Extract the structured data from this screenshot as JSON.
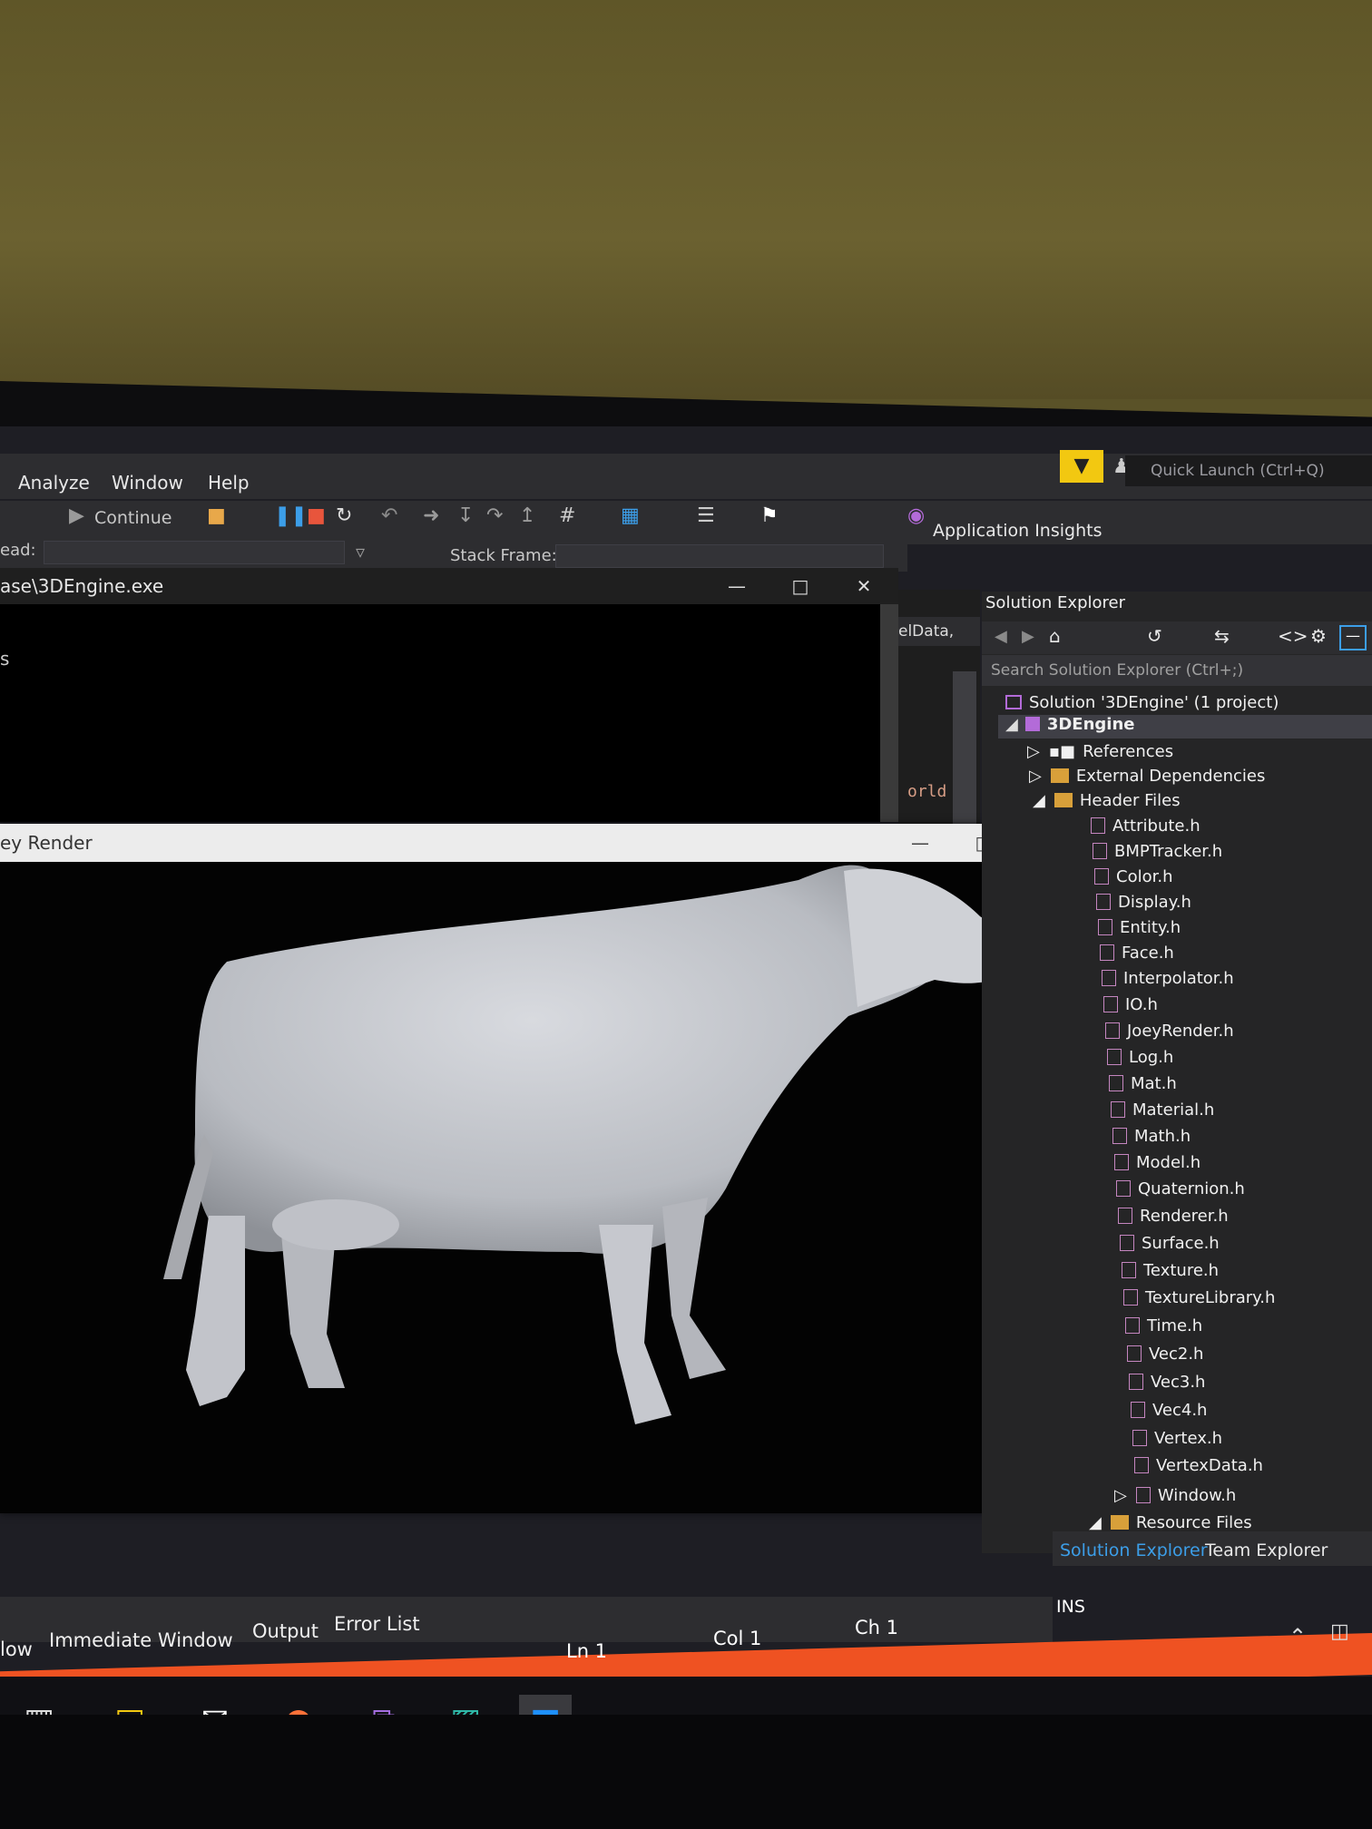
{
  "menu": {
    "items": [
      "Analyze",
      "Window",
      "Help"
    ],
    "quick_launch": "Quick Launch (Ctrl+Q)"
  },
  "toolbar": {
    "continue_label": "Continue",
    "application_insights": "Application Insights",
    "thread_label": "ead:",
    "stack_frame_label": "Stack Frame:"
  },
  "console": {
    "title": "ase\\3DEngine.exe",
    "text": "s"
  },
  "editor": {
    "tab_label": "elData,",
    "code_fragment": "orld"
  },
  "render_window": {
    "title": "ey Render"
  },
  "solution_explorer": {
    "title": "Solution Explorer",
    "search_placeholder": "Search Solution Explorer (Ctrl+;)",
    "solution": "Solution '3DEngine' (1 project)",
    "project": "3DEngine",
    "references": "References",
    "external_dependencies": "External Dependencies",
    "header_files": "Header Files",
    "files": [
      "Attribute.h",
      "BMPTracker.h",
      "Color.h",
      "Display.h",
      "Entity.h",
      "Face.h",
      "Interpolator.h",
      "IO.h",
      "JoeyRender.h",
      "Log.h",
      "Mat.h",
      "Material.h",
      "Math.h",
      "Model.h",
      "Quaternion.h",
      "Renderer.h",
      "Surface.h",
      "Texture.h",
      "TextureLibrary.h",
      "Time.h",
      "Vec2.h",
      "Vec3.h",
      "Vec4.h",
      "Vertex.h",
      "VertexData.h",
      "Window.h"
    ],
    "resource_files": "Resource Files",
    "tabs": [
      "Solution Explorer",
      "Team Explorer"
    ]
  },
  "bottom_tabs": [
    "low",
    "Immediate Window",
    "Output",
    "Error List"
  ],
  "status": {
    "ln": "Ln 1",
    "col": "Col 1",
    "ch": "Ch 1",
    "ins": "INS"
  },
  "colors": {
    "status_bar": "#ef5222",
    "ide_background": "#2d2d30",
    "accent": "#f2c811"
  }
}
